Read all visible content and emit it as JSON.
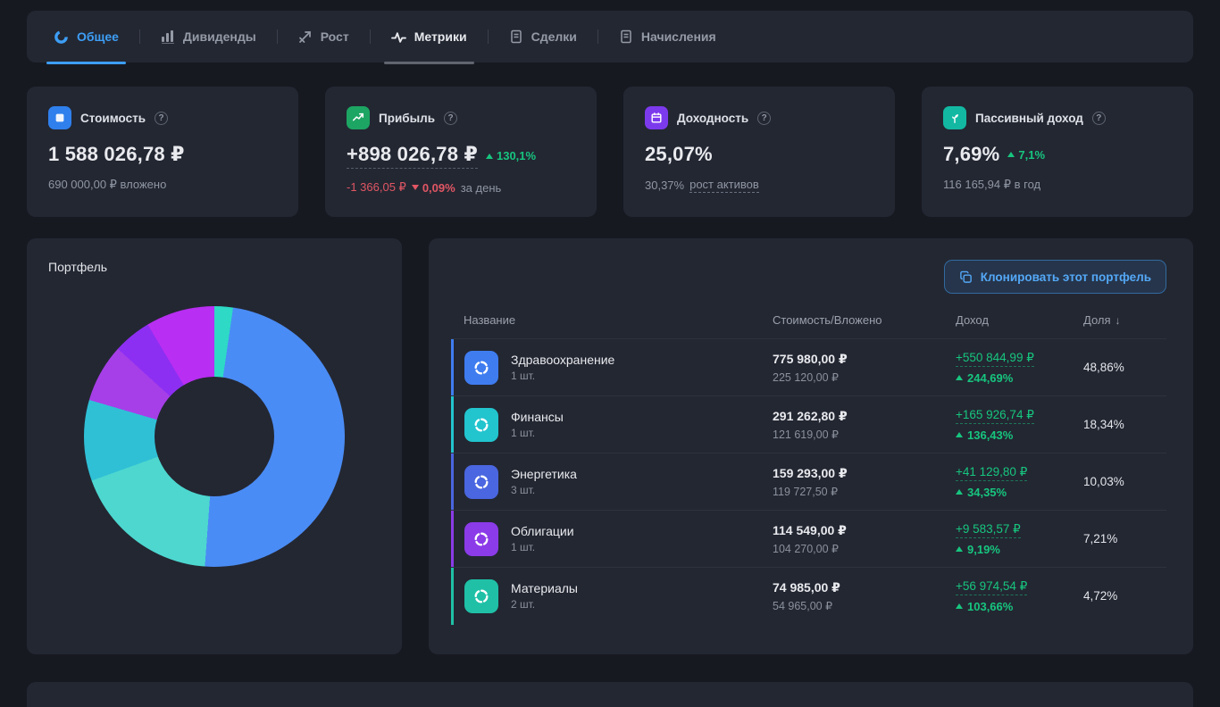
{
  "colors": {
    "accent_blue": "#3d9ef5",
    "green": "#17c57f",
    "red": "#e15664",
    "panel_bg": "#232732"
  },
  "nav": {
    "tabs": [
      {
        "label": "Общее",
        "active": true
      },
      {
        "label": "Дивиденды",
        "active": false
      },
      {
        "label": "Рост",
        "active": false
      },
      {
        "label": "Метрики",
        "active": false,
        "highlighted": true
      },
      {
        "label": "Сделки",
        "active": false
      },
      {
        "label": "Начисления",
        "active": false
      }
    ]
  },
  "cards": {
    "value": {
      "title": "Стоимость",
      "amount": "1 588 026,78 ₽",
      "sub": "690 000,00 ₽ вложено",
      "icon_color": "#2f80ed"
    },
    "profit": {
      "title": "Прибыль",
      "amount": "+898 026,78 ₽",
      "pct": "130,1%",
      "day_amount": "-1 366,05 ₽",
      "day_pct": "0,09%",
      "day_suffix": "за день",
      "icon_color": "#1da563"
    },
    "yield": {
      "title": "Доходность",
      "amount": "25,07%",
      "sub_value": "30,37%",
      "sub_link": "рост активов",
      "icon_color": "#7c3aed"
    },
    "passive": {
      "title": "Пассивный доход",
      "amount": "7,69%",
      "pct": "7,1%",
      "sub": "116 165,94 ₽ в год",
      "icon_color": "#12b8a2"
    }
  },
  "portfolio": {
    "title": "Портфель"
  },
  "chart_data": {
    "type": "pie",
    "title": "Портфель",
    "donut": true,
    "legend_position": "none",
    "segments": [
      {
        "label": "",
        "value": 2.3,
        "color": "#2ed9c6"
      },
      {
        "label": "Здравоохранение",
        "value": 48.86,
        "color": "#4a8cf5"
      },
      {
        "label": "Финансы",
        "value": 18.34,
        "color": "#4dd7cf"
      },
      {
        "label": "Энергетика",
        "value": 10.03,
        "color": "#2fc0d6"
      },
      {
        "label": "Облигации",
        "value": 7.21,
        "color": "#a63fe8"
      },
      {
        "label": "Материалы",
        "value": 4.72,
        "color": "#8d2ff2"
      },
      {
        "label": "",
        "value": 8.54,
        "color": "#b82ef2"
      }
    ]
  },
  "table": {
    "clone_button": "Клонировать этот портфель",
    "headers": {
      "name": "Название",
      "value": "Стоимость/Вложено",
      "income": "Доход",
      "share": "Доля"
    },
    "sort_icon": "↓",
    "rows": [
      {
        "name": "Здравоохранение",
        "qty": "1 шт.",
        "value": "775 980,00 ₽",
        "invested": "225 120,00 ₽",
        "income": "+550 844,99 ₽",
        "income_pct": "244,69%",
        "share": "48,86%",
        "color": "#3f7cf0"
      },
      {
        "name": "Финансы",
        "qty": "1 шт.",
        "value": "291 262,80 ₽",
        "invested": "121 619,00 ₽",
        "income": "+165 926,74 ₽",
        "income_pct": "136,43%",
        "share": "18,34%",
        "color": "#22c4ce"
      },
      {
        "name": "Энергетика",
        "qty": "3 шт.",
        "value": "159 293,00 ₽",
        "invested": "119 727,50 ₽",
        "income": "+41 129,80 ₽",
        "income_pct": "34,35%",
        "share": "10,03%",
        "color": "#4a66e0"
      },
      {
        "name": "Облигации",
        "qty": "1 шт.",
        "value": "114 549,00 ₽",
        "invested": "104 270,00 ₽",
        "income": "+9 583,57 ₽",
        "income_pct": "9,19%",
        "share": "7,21%",
        "color": "#8b3be8"
      },
      {
        "name": "Материалы",
        "qty": "2 шт.",
        "value": "74 985,00 ₽",
        "invested": "54 965,00 ₽",
        "income": "+56 974,54 ₽",
        "income_pct": "103,66%",
        "share": "4,72%",
        "color": "#1fc0a6"
      }
    ]
  }
}
